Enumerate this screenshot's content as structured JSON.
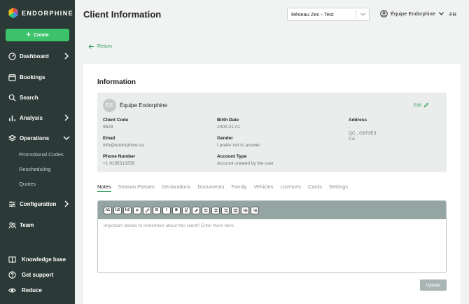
{
  "brand": {
    "name": "ENDORPHINE"
  },
  "sidebar": {
    "create_label": "Create",
    "items": [
      {
        "label": "Dashboard",
        "icon": "dashboard-icon",
        "expandable": true
      },
      {
        "label": "Bookings",
        "icon": "calendar-icon",
        "expandable": false
      },
      {
        "label": "Search",
        "icon": "search-icon",
        "expandable": false
      },
      {
        "label": "Analysis",
        "icon": "chart-icon",
        "expandable": true
      },
      {
        "label": "Operations",
        "icon": "operations-icon",
        "expandable": true,
        "expanded": true
      },
      {
        "label": "Configuration",
        "icon": "sliders-icon",
        "expandable": true
      },
      {
        "label": "Team",
        "icon": "team-icon",
        "expandable": false
      }
    ],
    "sub_items": [
      "Promotional Codes",
      "Rescheduling",
      "Quotes"
    ],
    "bottom": [
      {
        "label": "Knowledge base",
        "icon": "book-icon"
      },
      {
        "label": "Get support",
        "icon": "help-icon"
      },
      {
        "label": "Reduce",
        "icon": "eye-icon"
      }
    ]
  },
  "header": {
    "title": "Client Information",
    "network_select": "Réseau Zec - Test",
    "account": "Équipe Endorphine",
    "lang": "FR"
  },
  "return_label": "Return",
  "info": {
    "title": "Information",
    "avatar_initials": "ÉE",
    "client_name": "Équipe Endorphine",
    "edit_label": "Edit",
    "client_code_label": "Client Code",
    "client_code": "9628",
    "email_label": "Email",
    "email": "info@endorphine.ca",
    "phone_label": "Phone Number",
    "phone": "+1 8195313256",
    "birth_label": "Birth Date",
    "birth": "2000-01-01",
    "gender_label": "Gender",
    "gender": "I prefer not to answer",
    "account_type_label": "Account Type",
    "account_type": "Account created by the user",
    "address_label": "Address",
    "address_line1": "-",
    "address_line2": "QC , G9T3E3",
    "address_line3": "CA"
  },
  "tabs": [
    "Notes",
    "Season Passes",
    "Declarations",
    "Documents",
    "Family",
    "Vehicles",
    "Licences",
    "Cards",
    "Settings"
  ],
  "editor": {
    "placeholder": "Important details to remember about this client? Enter them here.",
    "toolbar": [
      "h1",
      "h2",
      "h3",
      "p",
      "link",
      "B",
      "I",
      "S",
      "U",
      "highlight",
      "align-left",
      "align-center",
      "align-right",
      "justify",
      "list-ul",
      "list-ol"
    ]
  },
  "update_label": "Update",
  "colors": {
    "sidebar": "#2c3a37",
    "accent": "#3cc26b",
    "link": "#2e9d5a"
  }
}
